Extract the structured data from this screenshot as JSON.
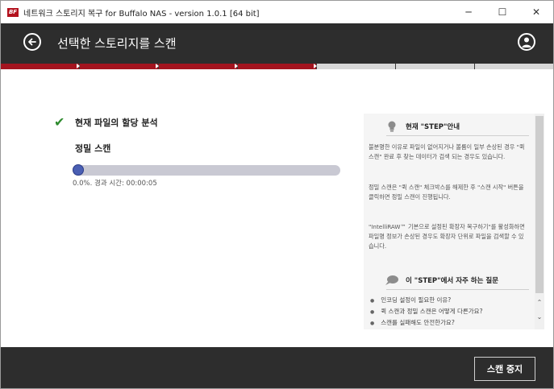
{
  "window": {
    "app_icon_text": "BF",
    "title": "네트워크 스토리지 복구 for Buffalo NAS - version 1.0.1 [64 bit]",
    "minimize_glyph": "─",
    "maximize_glyph": "☐",
    "close_glyph": "✕"
  },
  "header": {
    "title": "선택한 스토리지를 스캔"
  },
  "steps": {
    "completed": 4,
    "total": 7
  },
  "main": {
    "task_title": "현재 파일의 할당 분석",
    "scan_label": "정밀 스캔",
    "progress_fraction": 0.0,
    "progress_text": "0.0%. 경과 시간: 00:00:05"
  },
  "help": {
    "step_heading": "현재 \"STEP\"안내",
    "paragraphs": [
      "불분명한 이유로 파일이 없어지거나 볼륨이 일부 손상된 경우 \"퀵 스캔\" 완료 후 찾는 데이터가 검색 되는 경우도 있습니다.",
      "정밀 스캔은 \"퀵 스캔\" 체크박스를 해제한 후 \"스캔 시작\" 버튼을 클릭하면 정밀 스캔이 진행됩니다.",
      "\"IntelliRAW™ 기본으로 설정된 확장자 복구하기\"를 활성화하면 파일명 정보가 손상된 경우도 확장자 단위로 파일을 검색할 수 있습니다."
    ],
    "faq_heading": "이 \"STEP\"에서 자주 하는 질문",
    "faq_items": [
      "인코딩 설정이 필요한 이유?",
      "퀵 스캔과 정밀 스캔은 어떻게 다른가요?",
      "스캔를 실패해도 안전한가요?"
    ]
  },
  "footer": {
    "stop_label": "스캔 중지"
  }
}
